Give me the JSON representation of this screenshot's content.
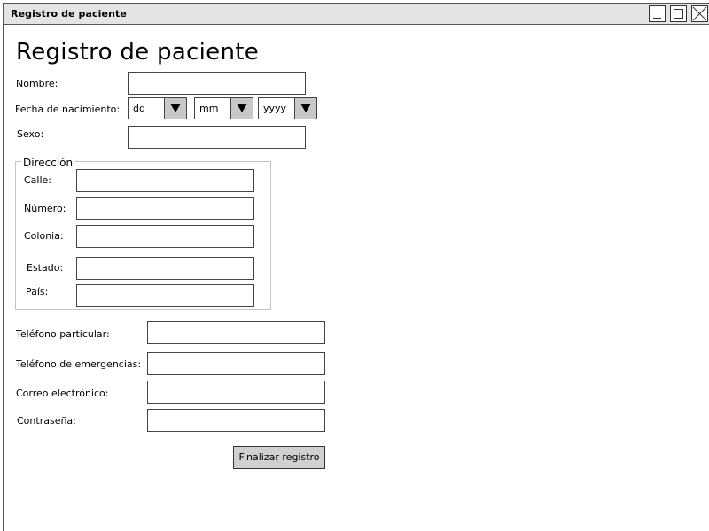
{
  "window": {
    "title": "Registro de paciente"
  },
  "form": {
    "heading": "Registro de paciente",
    "nombre_label": "Nombre:",
    "nombre_value": "",
    "fecha_label": "Fecha de nacimiento:",
    "day_value": "dd",
    "month_value": "mm",
    "year_value": "yyyy",
    "sexo_label": "Sexo:",
    "sexo_value": "",
    "direccion": {
      "legend": "Dirección",
      "calle_label": "Calle:",
      "numero_label": "Número:",
      "colonia_label": "Colonia:",
      "estado_label": "Estado:",
      "pais_label": "País:"
    },
    "telefono_particular_label": "Teléfono particular:",
    "telefono_emergencias_label": "Teléfono de emergencias:",
    "correo_label": "Correo electrónico:",
    "contrasena_label": "Contraseña:",
    "submit_label": "Finalizar registro"
  },
  "icons": {
    "minimize": "minimize-icon",
    "maximize": "maximize-icon",
    "close": "close-icon",
    "dropdown": "triangle-down-icon"
  },
  "colors": {
    "titlebar": "#e4e4e4",
    "button": "#d0d0d0",
    "dropdown_arrow": "#c8c8c8"
  }
}
